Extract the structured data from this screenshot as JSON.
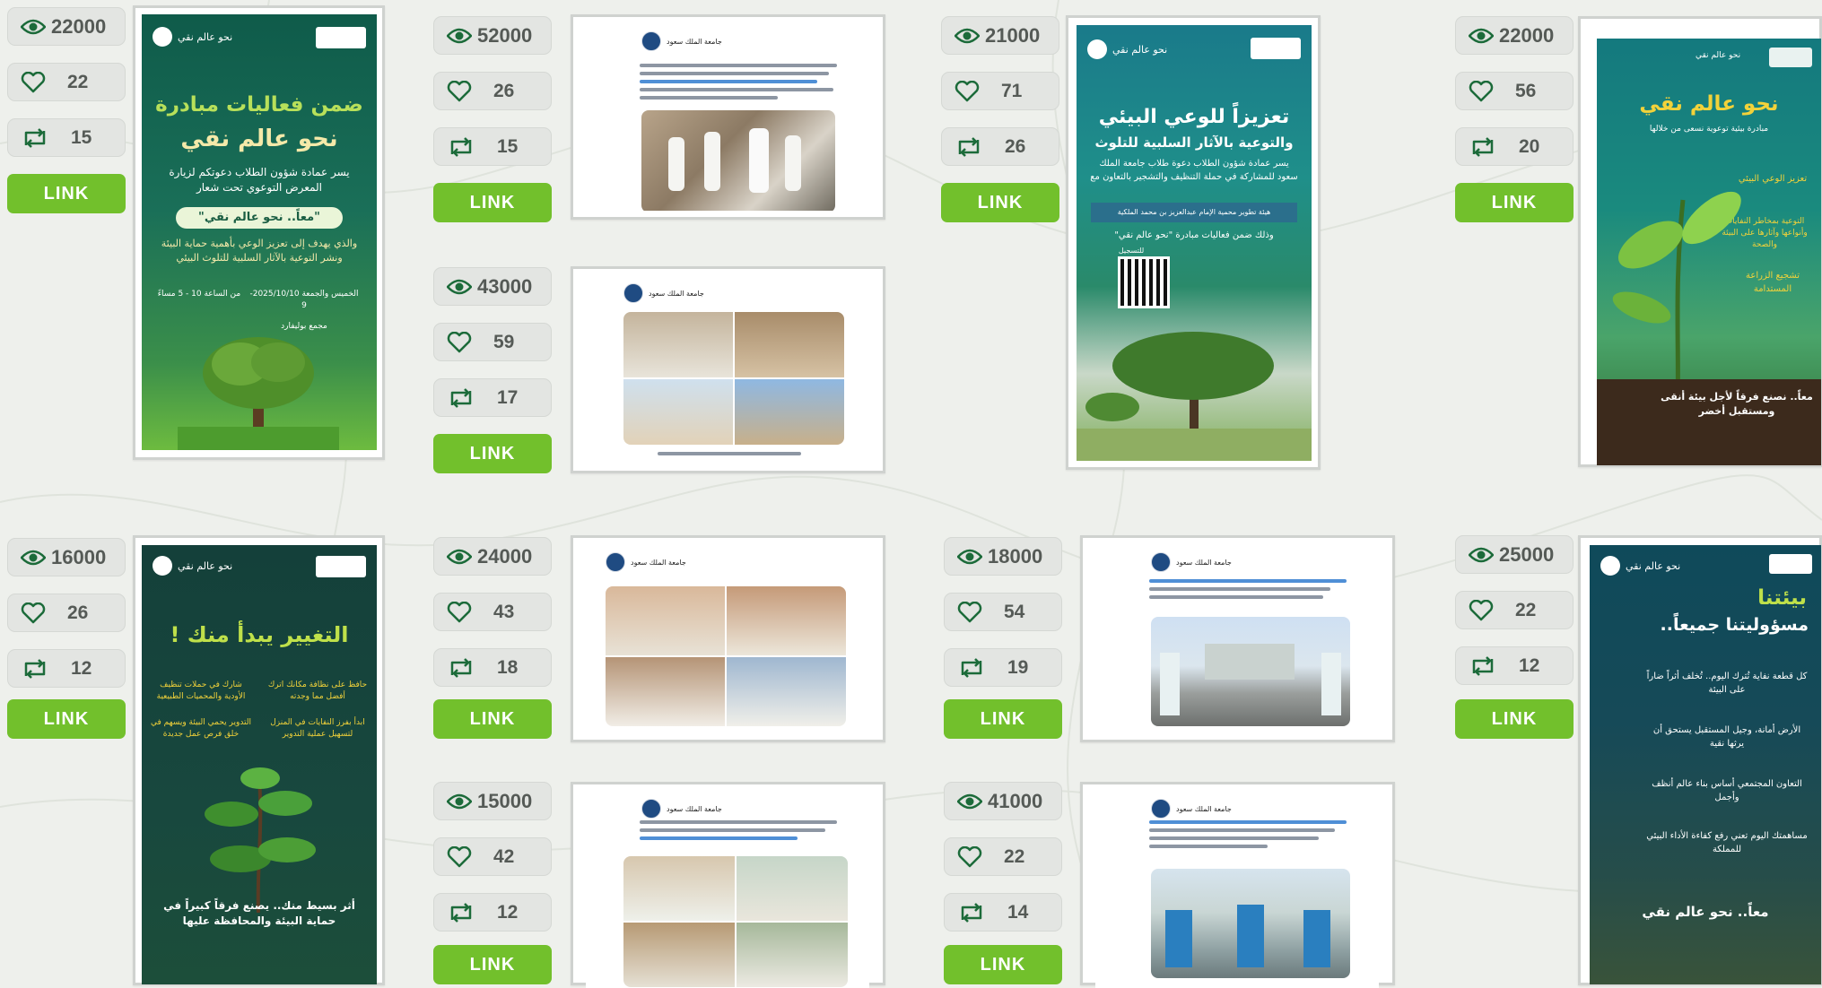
{
  "link_label": "LINK",
  "colors": {
    "accent": "#72c02c",
    "pill_bg": "#e3e5e2",
    "pill_text": "#555a56",
    "background": "#eef0ec"
  },
  "icons": {
    "views": "eye-icon",
    "likes": "heart-icon",
    "shares": "retweet-icon"
  },
  "entries": [
    {
      "views": "22000",
      "likes": "22",
      "shares": "15",
      "media": "poster",
      "poster": {
        "brand": "نحو عالم نقي",
        "title1": "ضمن فعاليات مبادرة",
        "title2": "نحو عالم نقي",
        "body": "يسر عمادة شؤون الطلاب دعوتكم لزيارة المعرض التوعوي تحت شعار",
        "banner": "\"معاً.. نحو عالم نقي\"",
        "body2": "والذي يهدف إلى تعزيز الوعي بأهمية حماية البيئة ونشر التوعية بالآثار السلبية للتلوث البيئي",
        "date": "الخميس والجمعة 2025/10/10-9",
        "time": "من الساعة 10 - 5 مساءً",
        "place": "مجمع بوليفارد"
      }
    },
    {
      "views": "52000",
      "likes": "26",
      "shares": "15",
      "media": "tweet",
      "account": "جامعة الملك سعود"
    },
    {
      "views": "21000",
      "likes": "71",
      "shares": "26",
      "media": "poster",
      "poster": {
        "brand": "نحو عالم نقي",
        "title1": "تعزيزاً للوعي البيئي",
        "title2": "والتوعية بالآثار السلبية للتلوث",
        "body": "يسر عمادة شؤون الطلاب دعوة طلاب جامعة الملك سعود للمشاركة في حملة التنظيف والتشجير بالتعاون مع",
        "banner": "هيئة تطوير محمية الإمام عبدالعزيز بن محمد الملكية",
        "body2": "وذلك ضمن فعاليات مبادرة \"نحو عالم نقي\"",
        "reg": "للتسجيل"
      }
    },
    {
      "views": "22000",
      "likes": "56",
      "shares": "20",
      "media": "poster",
      "poster": {
        "brand": "نحو عالم نقي",
        "title1": "نحو عالم نقي",
        "title2": "مبادرة بيئية توعوية نسعى من خلالها",
        "body": "تعزيز الوعي البيئي",
        "banner": "التوعية بمخاطر النفايات وأنواعها وآثارها على البيئة والصحة",
        "body2": "تشجيع الزراعة المستدامة",
        "footer": "معاً.. نصنع فرقاً لأجل بيئة أنقى ومستقبل أخضر"
      }
    },
    {
      "views": "43000",
      "likes": "59",
      "shares": "17",
      "media": "tweet",
      "account": "جامعة الملك سعود"
    },
    {
      "views": "16000",
      "likes": "26",
      "shares": "12",
      "media": "poster",
      "poster": {
        "brand": "نحو عالم نقي",
        "title1": "التغيير يبدأ منك !",
        "title2": "",
        "body": "حافظ على نظافة مكانك اترك أفضل مما وجدته",
        "banner": "شارك في حملات تنظيف الأودية والمحميات الطبيعية",
        "body2": "ابدأ بفرز النفايات في المنزل لتسهيل عملية التدوير",
        "extra": "التدوير يحمي البيئة ويسهم في خلق فرص عمل جديدة",
        "footer": "أثر بسيط منك.. يصنع فرقاً كبيراً في حماية البيئة والمحافظة عليها"
      }
    },
    {
      "views": "24000",
      "likes": "43",
      "shares": "18",
      "media": "tweet",
      "account": "جامعة الملك سعود"
    },
    {
      "views": "18000",
      "likes": "54",
      "shares": "19",
      "media": "tweet",
      "account": "جامعة الملك سعود"
    },
    {
      "views": "25000",
      "likes": "22",
      "shares": "12",
      "media": "poster",
      "poster": {
        "brand": "نحو عالم نقي",
        "title1": "بيئتنا",
        "title2": "مسؤوليتنا جميعاً..",
        "body": "كل قطعة نفاية تُترك اليوم.. تُخلف أثراً ضاراً على البيئة",
        "banner": "الأرض أمانة، وجيل المستقبل يستحق أن يرثها نقية",
        "body2": "التعاون المجتمعي أساس بناء عالم أنظف وأجمل",
        "extra": "مساهمتك اليوم تعني رفع كفاءة الأداء البيئي للمملكة",
        "footer": "معاً.. نحو عالم نقي"
      }
    },
    {
      "views": "15000",
      "likes": "42",
      "shares": "12",
      "media": "tweet",
      "account": "جامعة الملك سعود"
    },
    {
      "views": "41000",
      "likes": "22",
      "shares": "14",
      "media": "tweet",
      "account": "جامعة الملك سعود"
    }
  ]
}
